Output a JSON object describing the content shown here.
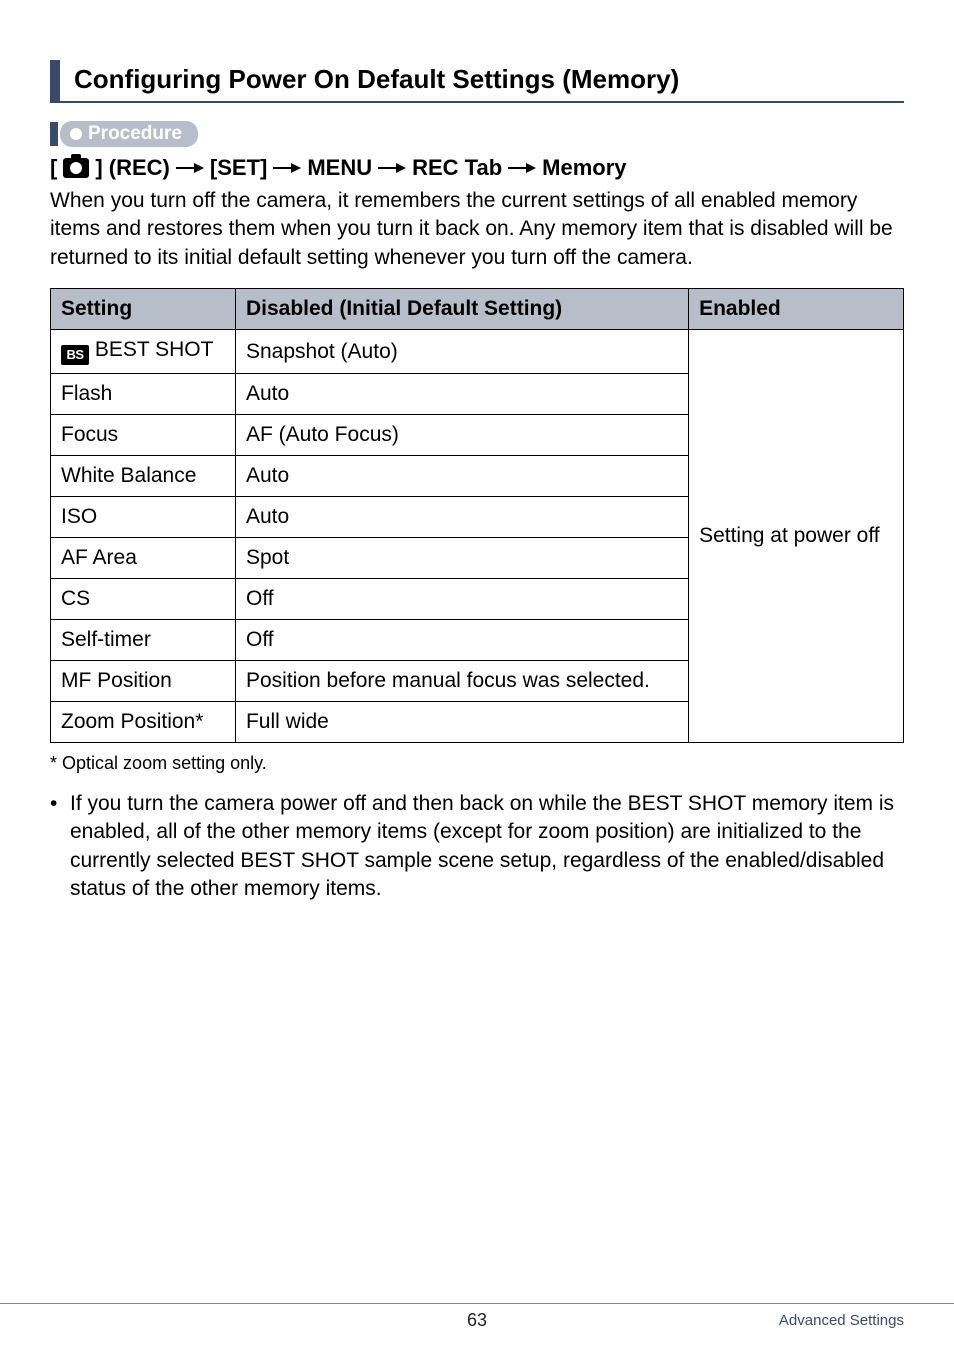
{
  "heading": "Configuring Power On Default Settings (Memory)",
  "procedure_label": "Procedure",
  "path": {
    "rec_prefix_open": "[",
    "rec_prefix_close": "] (REC)",
    "set": "[SET]",
    "menu": "MENU",
    "rec_tab": "REC Tab",
    "memory": "Memory"
  },
  "intro": "When you turn off the camera, it remembers the current settings of all enabled memory items and restores them when you turn it back on. Any memory item that is disabled will be returned to its initial default setting whenever you turn off the camera.",
  "table": {
    "headers": {
      "setting": "Setting",
      "disabled": "Disabled (Initial Default Setting)",
      "enabled": "Enabled"
    },
    "rows": [
      {
        "setting": " BEST SHOT",
        "disabled": "Snapshot (Auto)"
      },
      {
        "setting": "Flash",
        "disabled": "Auto"
      },
      {
        "setting": "Focus",
        "disabled": "AF (Auto Focus)"
      },
      {
        "setting": "White Balance",
        "disabled": "Auto"
      },
      {
        "setting": "ISO",
        "disabled": "Auto"
      },
      {
        "setting": "AF Area",
        "disabled": "Spot"
      },
      {
        "setting": "CS",
        "disabled": "Off"
      },
      {
        "setting": "Self-timer",
        "disabled": "Off"
      },
      {
        "setting": "MF Position",
        "disabled": "Position before manual focus was selected."
      },
      {
        "setting": "Zoom Position*",
        "disabled": "Full wide"
      }
    ],
    "enabled_text": "Setting at power off"
  },
  "footnote_marker": "*",
  "footnote_text": "Optical zoom setting only.",
  "bullet": "If you turn the camera power off and then back on while the BEST SHOT memory item is enabled, all of the other memory items (except for zoom position) are initialized to the currently selected BEST SHOT sample scene setup, regardless of the enabled/disabled status of the other memory items.",
  "footer": {
    "page": "63",
    "section": "Advanced Settings"
  },
  "icons": {
    "bs_text": "BS"
  }
}
